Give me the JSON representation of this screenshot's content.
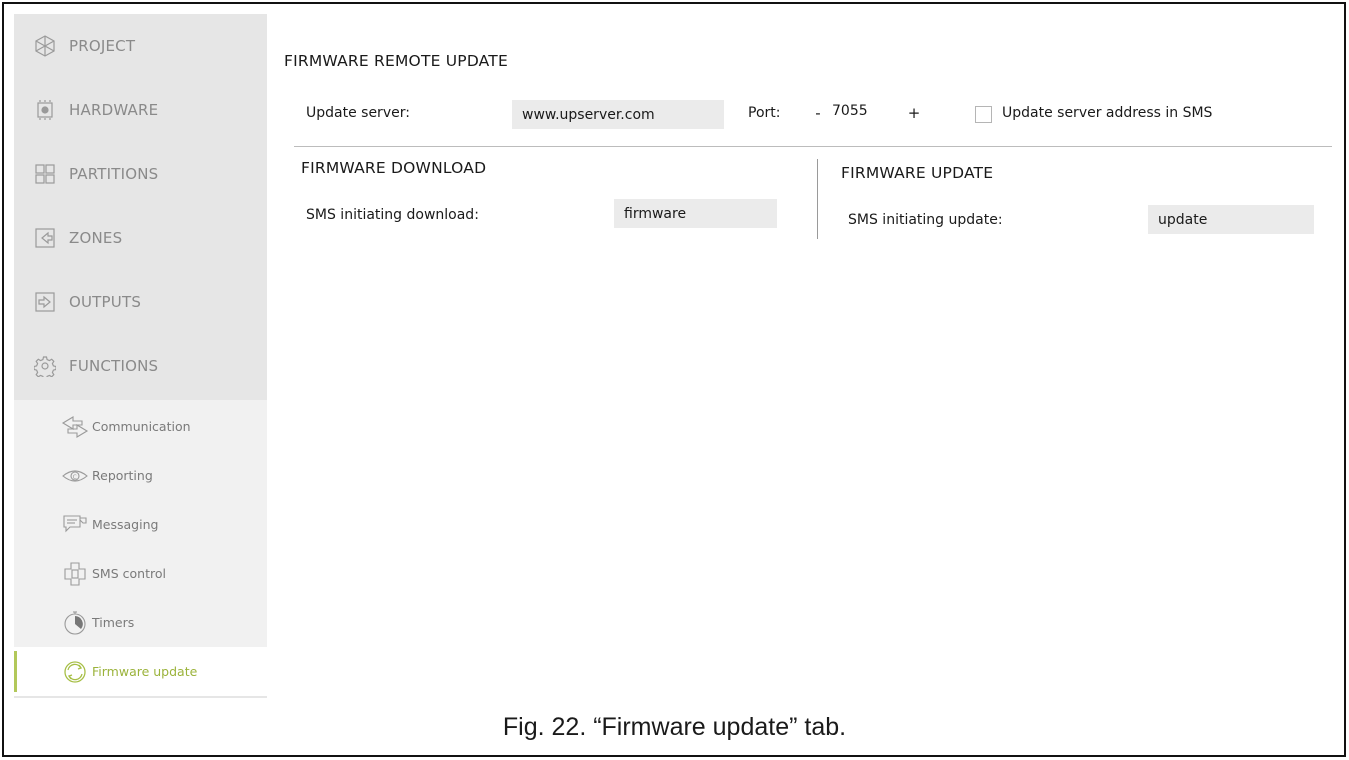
{
  "sidebar": {
    "main_items": [
      {
        "label": "PROJECT",
        "icon": "project-icon"
      },
      {
        "label": "HARDWARE",
        "icon": "hardware-icon"
      },
      {
        "label": "PARTITIONS",
        "icon": "partitions-icon"
      },
      {
        "label": "ZONES",
        "icon": "zones-icon"
      },
      {
        "label": "OUTPUTS",
        "icon": "outputs-icon"
      },
      {
        "label": "FUNCTIONS",
        "icon": "functions-icon"
      }
    ],
    "sub_items": [
      {
        "label": "Communication",
        "icon": "communication-icon"
      },
      {
        "label": "Reporting",
        "icon": "reporting-icon"
      },
      {
        "label": "Messaging",
        "icon": "messaging-icon"
      },
      {
        "label": "SMS control",
        "icon": "sms-control-icon"
      },
      {
        "label": "Timers",
        "icon": "timers-icon"
      },
      {
        "label": "Firmware update",
        "icon": "firmware-update-icon",
        "active": true
      }
    ],
    "text_color": "#8a8a8a",
    "accent_color": "#9bb33b"
  },
  "remote_update": {
    "title": "FIRMWARE REMOTE UPDATE",
    "server_label": "Update server:",
    "server_value": "www.upserver.com",
    "port_label": "Port:",
    "port_minus": "-",
    "port_value": "7055",
    "port_plus": "+",
    "sms_checkbox_label": "Update server address in SMS",
    "sms_checkbox_checked": false
  },
  "download": {
    "title": "FIRMWARE DOWNLOAD",
    "sms_label": "SMS initiating download:",
    "sms_value": "firmware"
  },
  "update": {
    "title": "FIRMWARE UPDATE",
    "sms_label": "SMS initiating update:",
    "sms_value": "update"
  },
  "caption": "Fig. 22. “Firmware update” tab."
}
